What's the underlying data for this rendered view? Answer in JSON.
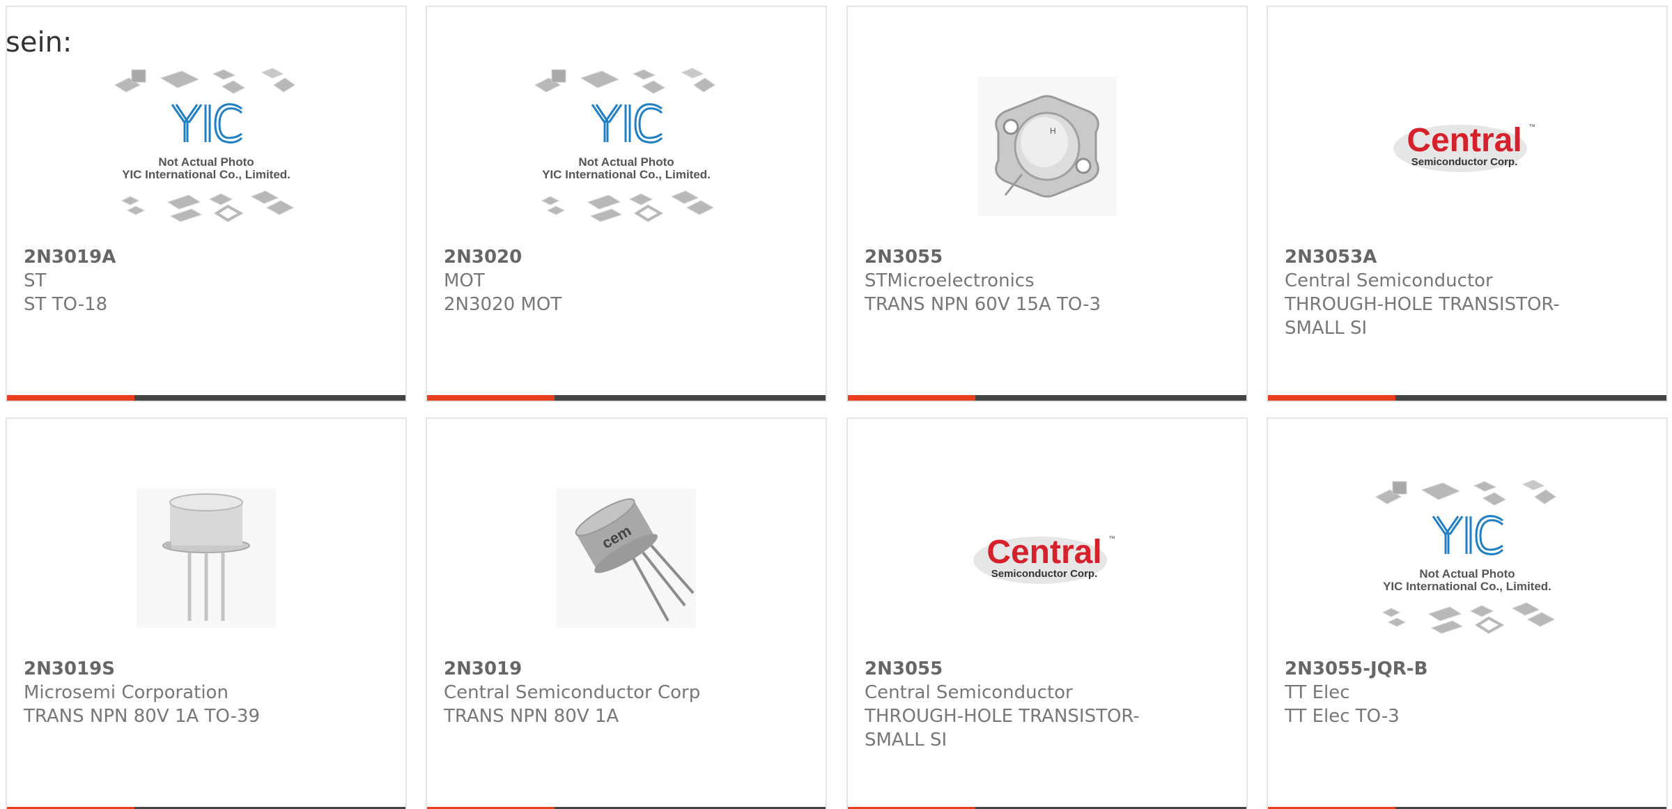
{
  "intro_text": "sein:",
  "placeholder": {
    "brand": "YIC",
    "line1": "Not Actual Photo",
    "line2": "YIC International Co., Limited."
  },
  "central_logo": {
    "brand": "Central",
    "trademark": "™",
    "subtitle": "Semiconductor Corp."
  },
  "colors": {
    "accent": "#e8401c",
    "bar": "#444444",
    "text": "#777777",
    "brand_blue": "#1e7fc4",
    "central_red": "#d6202b"
  },
  "products": [
    {
      "part": "2N3019A",
      "maker": "ST",
      "desc": "ST TO-18",
      "image": "yic-placeholder"
    },
    {
      "part": "2N3020",
      "maker": "MOT",
      "desc": "2N3020 MOT",
      "image": "yic-placeholder"
    },
    {
      "part": "2N3055",
      "maker": "STMicroelectronics",
      "desc": "TRANS NPN 60V 15A TO-3",
      "image": "to3-transistor"
    },
    {
      "part": "2N3053A",
      "maker": "Central Semiconductor",
      "desc": "THROUGH-HOLE TRANSISTOR-SMALL SI",
      "image": "central-logo"
    },
    {
      "part": "2N3019S",
      "maker": "Microsemi Corporation",
      "desc": "TRANS NPN 80V 1A TO-39",
      "image": "to39-transistor"
    },
    {
      "part": "2N3019",
      "maker": "Central Semiconductor Corp",
      "desc": "TRANS NPN 80V 1A",
      "image": "to39-tilted-transistor"
    },
    {
      "part": "2N3055",
      "maker": "Central Semiconductor",
      "desc": "THROUGH-HOLE TRANSISTOR-SMALL SI",
      "image": "central-logo"
    },
    {
      "part": "2N3055-JQR-B",
      "maker": "TT Elec",
      "desc": "TT Elec TO-3",
      "image": "yic-placeholder"
    }
  ]
}
